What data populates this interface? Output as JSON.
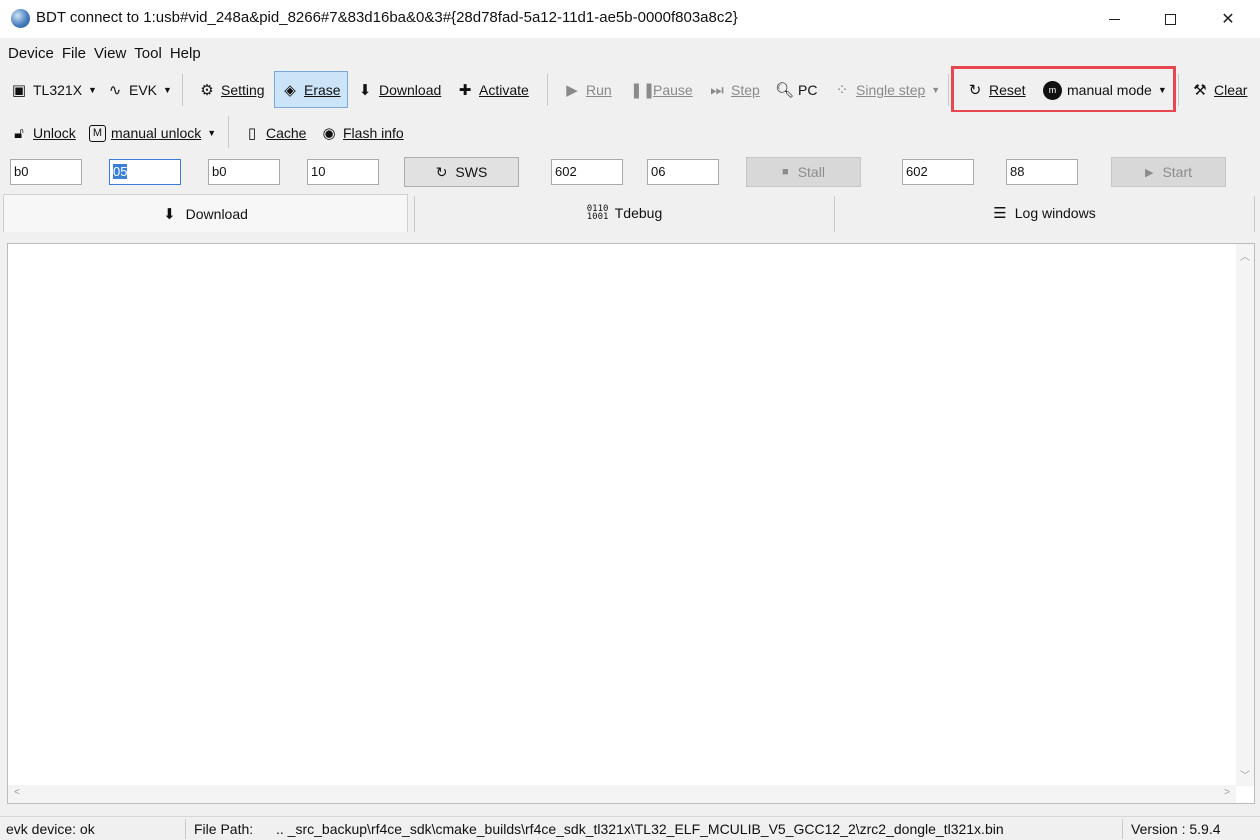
{
  "window": {
    "title": "BDT connect to 1:usb#vid_248a&pid_8266#7&83d16ba&0&3#{28d78fad-5a12-11d1-ae5b-0000f803a8c2}",
    "minimize_icon": "minimize-icon",
    "maximize_icon": "maximize-icon",
    "close_icon": "close-icon"
  },
  "menu": [
    "Device",
    "File",
    "View",
    "Tool",
    "Help"
  ],
  "toolbar1": {
    "chip": "TL321X",
    "board": "EVK",
    "setting": "Setting",
    "erase": "Erase",
    "download": "Download",
    "activate": "Activate",
    "run": "Run",
    "pause": "Pause",
    "step": "Step",
    "pc": "PC",
    "single_step": "Single step",
    "reset": "Reset",
    "mode": "manual mode",
    "clear": "Clear",
    "highlight_color": "#e8474f"
  },
  "toolbar2": {
    "unlock": "Unlock",
    "manual_unlock": "manual unlock",
    "cache": "Cache",
    "flash_info": "Flash info"
  },
  "toolbar3": {
    "field1": "b0",
    "field2": "05",
    "field3": "b0",
    "field4": "10",
    "sws": "SWS",
    "field5": "602",
    "field6": "06",
    "stall": "Stall",
    "field7": "602",
    "field8": "88",
    "start": "Start"
  },
  "tabs": [
    "Download",
    "Tdebug",
    "Log windows"
  ],
  "status": {
    "device": "evk device: ok",
    "file_path_label": "File Path:",
    "file_path": "..  _src_backup\\rf4ce_sdk\\cmake_builds\\rf4ce_sdk_tl321x\\TL32_ELF_MCULIB_V5_GCC12_2\\zrc2_dongle_tl321x.bin",
    "version": "Version : 5.9.4"
  }
}
